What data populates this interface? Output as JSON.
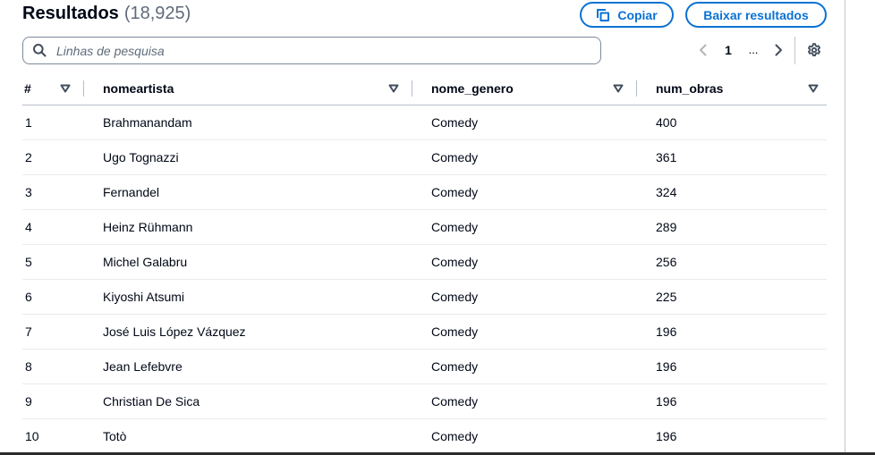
{
  "header": {
    "title": "Resultados",
    "count": "(18,925)"
  },
  "actions": {
    "copy_label": "Copiar",
    "download_label": "Baixar resultados"
  },
  "search": {
    "placeholder": "Linhas de pesquisa",
    "value": ""
  },
  "pagination": {
    "current_page": "1",
    "ellipsis": "...",
    "previous_enabled": false,
    "next_enabled": true
  },
  "table": {
    "columns": [
      "#",
      "nomeartista",
      "nome_genero",
      "num_obras"
    ],
    "rows": [
      {
        "index": "1",
        "nomeartista": "Brahmanandam",
        "nome_genero": "Comedy",
        "num_obras": "400"
      },
      {
        "index": "2",
        "nomeartista": "Ugo Tognazzi",
        "nome_genero": "Comedy",
        "num_obras": "361"
      },
      {
        "index": "3",
        "nomeartista": "Fernandel",
        "nome_genero": "Comedy",
        "num_obras": "324"
      },
      {
        "index": "4",
        "nomeartista": "Heinz Rühmann",
        "nome_genero": "Comedy",
        "num_obras": "289"
      },
      {
        "index": "5",
        "nomeartista": "Michel Galabru",
        "nome_genero": "Comedy",
        "num_obras": "256"
      },
      {
        "index": "6",
        "nomeartista": "Kiyoshi Atsumi",
        "nome_genero": "Comedy",
        "num_obras": "225"
      },
      {
        "index": "7",
        "nomeartista": "José Luis López Vázquez",
        "nome_genero": "Comedy",
        "num_obras": "196"
      },
      {
        "index": "8",
        "nomeartista": "Jean Lefebvre",
        "nome_genero": "Comedy",
        "num_obras": "196"
      },
      {
        "index": "9",
        "nomeartista": "Christian De Sica",
        "nome_genero": "Comedy",
        "num_obras": "196"
      },
      {
        "index": "10",
        "nomeartista": "Totò",
        "nome_genero": "Comedy",
        "num_obras": "196"
      }
    ]
  },
  "icons": {
    "copy": "copy-icon",
    "search": "search-icon",
    "previous": "chevron-left-icon",
    "next": "chevron-right-icon",
    "settings": "gear-icon",
    "sort": "sort-down-icon"
  },
  "colors": {
    "accent": "#0972d3",
    "text": "#000716",
    "muted": "#5f6b7a",
    "icon": "#414d5c",
    "disabled": "#b4b4bb",
    "input_border": "#7d8998",
    "header_divider": "#b6bec9",
    "row_divider": "#e9ebed",
    "panel_border": "#c6c6cd",
    "bottom_edge": "#2b2b2b"
  }
}
